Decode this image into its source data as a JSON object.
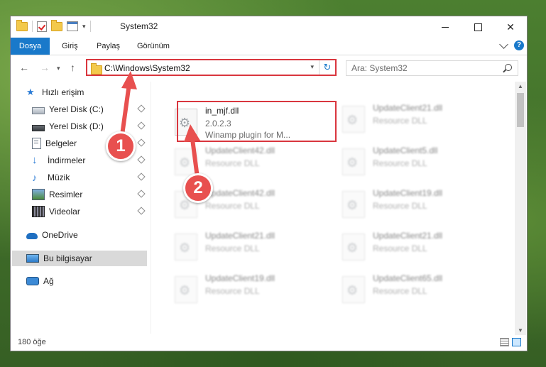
{
  "window": {
    "title": "System32"
  },
  "ribbon": {
    "tabs": [
      "Dosya",
      "Giriş",
      "Paylaş",
      "Görünüm"
    ],
    "help_label": "?"
  },
  "nav": {
    "address": "C:\\Windows\\System32",
    "search_placeholder": "Ara: System32"
  },
  "sidebar": {
    "items": [
      {
        "label": "Hızlı erişim",
        "icon": "star-icon"
      },
      {
        "label": "Yerel Disk (C:)",
        "icon": "disk-icon"
      },
      {
        "label": "Yerel Disk (D:)",
        "icon": "disk-icon"
      },
      {
        "label": "Belgeler",
        "icon": "documents-icon"
      },
      {
        "label": "İndirmeler",
        "icon": "download-icon"
      },
      {
        "label": "Müzik",
        "icon": "music-icon"
      },
      {
        "label": "Resimler",
        "icon": "pictures-icon"
      },
      {
        "label": "Videolar",
        "icon": "video-icon"
      },
      {
        "label": "OneDrive",
        "icon": "cloud-icon"
      },
      {
        "label": "Bu bilgisayar",
        "icon": "computer-icon"
      },
      {
        "label": "Ağ",
        "icon": "network-icon"
      }
    ]
  },
  "files": [
    {
      "name": "in_mjf.dll",
      "version": "2.0.2.3",
      "description": "Winamp plugin for M..."
    },
    {
      "name": "UpdateClient21.dll",
      "description": "Resource DLL"
    },
    {
      "name": "UpdateClient42.dll",
      "description": "Resource DLL"
    },
    {
      "name": "UpdateClient5.dll",
      "description": "Resource DLL"
    },
    {
      "name": "UpdateClient42.dll",
      "description": "Resource DLL"
    },
    {
      "name": "UpdateClient19.dll",
      "description": "Resource DLL"
    },
    {
      "name": "UpdateClient21.dll",
      "description": "Resource DLL"
    },
    {
      "name": "UpdateClient21.dll",
      "description": "Resource DLL"
    },
    {
      "name": "UpdateClient19.dll",
      "description": "Resource DLL"
    },
    {
      "name": "UpdateClient65.dll",
      "description": "Resource DLL"
    }
  ],
  "status": {
    "item_count": "180 öğe"
  },
  "callouts": [
    "1",
    "2"
  ],
  "colors": {
    "accent": "#1979ca",
    "highlight": "#d9363e",
    "callout": "#e8504f"
  }
}
